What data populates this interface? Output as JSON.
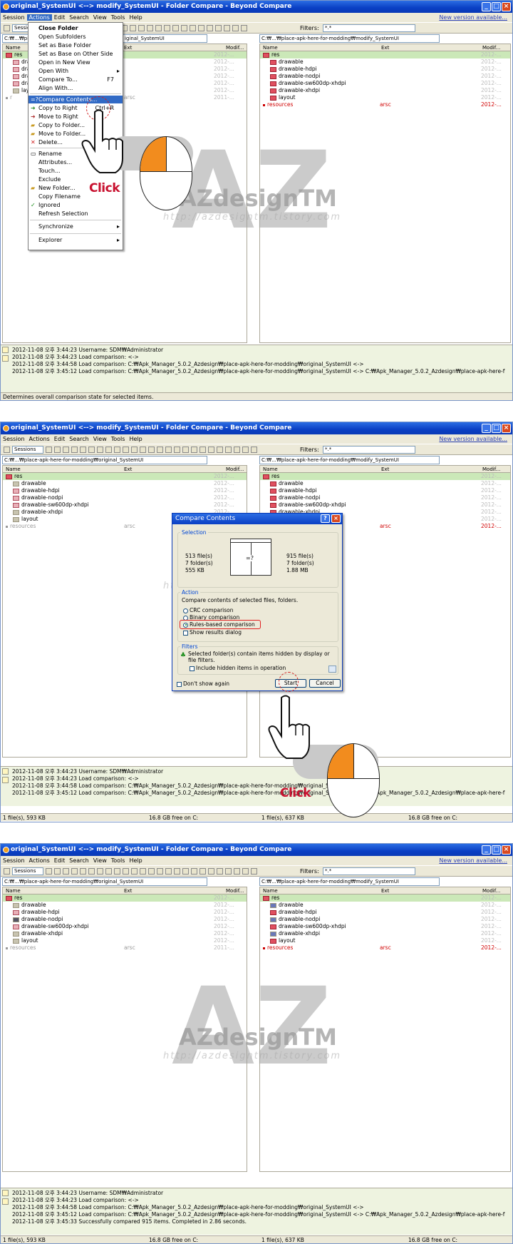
{
  "window": {
    "title": "original_SystemUI <--> modify_SystemUI - Folder Compare - Beyond Compare",
    "new_version": "New version available..."
  },
  "menu": [
    "Session",
    "Actions",
    "Edit",
    "Search",
    "View",
    "Tools",
    "Help"
  ],
  "toolbar": {
    "sessions": "Sessions",
    "filters_label": "Filters:",
    "filter_value": "*.*"
  },
  "paths": {
    "left": "C:₩...₩place-apk-here-for-modding₩original_SystemUI",
    "right": "C:₩...₩place-apk-here-for-modding₩modify_SystemUI",
    "left_short": "C:₩...₩pl",
    "left_tail": "iginal_SystemUI"
  },
  "columns": {
    "name": "Name",
    "ext": "Ext",
    "modified": "Modif..."
  },
  "tree": {
    "root": "res",
    "folders": [
      "drawable",
      "drawable-hdpi",
      "drawable-nodpi",
      "drawable-sw600dp-xhdpi",
      "drawable-xhdpi",
      "layout"
    ],
    "resources": "resources",
    "ext": "arsc",
    "mod_left": "2012-...",
    "mod_left_old": "2011-...",
    "mod_right": "2012-..."
  },
  "actions_menu": [
    {
      "label": "Close Folder",
      "bold": true
    },
    {
      "label": "Open Subfolders"
    },
    {
      "label": "Set as Base Folder"
    },
    {
      "label": "Set as Base on Other Side"
    },
    {
      "label": "Open in New View"
    },
    {
      "label": "Open With",
      "submenu": true
    },
    {
      "label": "Compare To...",
      "shortcut": "F7"
    },
    {
      "label": "Align With..."
    },
    {
      "label": "Compare Contents...",
      "highlighted": true,
      "icon": "=?"
    },
    {
      "label": "Copy to Right",
      "shortcut": "Ctrl+R"
    },
    {
      "label": "Move to Right"
    },
    {
      "label": "Copy to Folder..."
    },
    {
      "label": "Move to Folder..."
    },
    {
      "label": "Delete..."
    },
    {
      "label": "Rename"
    },
    {
      "label": "Attributes..."
    },
    {
      "label": "Touch..."
    },
    {
      "label": "Exclude"
    },
    {
      "label": "New Folder..."
    },
    {
      "label": "Copy Filename"
    },
    {
      "label": "Ignored",
      "check": true
    },
    {
      "label": "Refresh Selection"
    },
    {
      "label": "Synchronize",
      "submenu": true
    },
    {
      "label": "Explorer",
      "submenu": true
    }
  ],
  "log": {
    "l1": "2012-11-08 오후 3:44:23  Username: SDM₩Administrator",
    "l2": "2012-11-08 오후 3:44:23  Load comparison:  <->",
    "l3": "2012-11-08 오후 3:44:58  Load comparison: C:₩Apk_Manager_5.0.2_Azdesign₩place-apk-here-for-modding₩original_SystemUI <->",
    "l4": "2012-11-08 오후 3:45:12  Load comparison: C:₩Apk_Manager_5.0.2_Azdesign₩place-apk-here-for-modding₩original_SystemUI <-> C:₩Apk_Manager_5.0.2_Azdesign₩place-apk-here-f",
    "l5": "2012-11-08 오후 3:45:33  Successfully compared 915 items.   Completed in 2.86 seconds."
  },
  "status": {
    "hint": "Determines overall comparison state for selected items.",
    "left_files": "1 file(s), 593 KB",
    "left_free": "16.8 GB free on C:",
    "right_files": "1 file(s), 637 KB",
    "right_free": "16.8 GB free on C:"
  },
  "dialog": {
    "title": "Compare Contents",
    "selection_label": "Selection",
    "left_files": "513 file(s)",
    "left_folders": "7 folder(s)",
    "left_size": "555 KB",
    "right_files": "915 file(s)",
    "right_folders": "7 folder(s)",
    "right_size": "1.88 MB",
    "action_label": "Action",
    "action_desc": "Compare contents of selected files, folders.",
    "crc": "CRC comparison",
    "binary": "Binary comparison",
    "rules": "Rules-based comparison",
    "show_results": "Show results dialog",
    "filters_label": "Filters",
    "filters_desc1": "Selected folder(s) contain items hidden by display or",
    "filters_desc2": "file filters.",
    "include_hidden": "Include hidden items in operation",
    "dont_show": "Don't show again",
    "start": "Start",
    "cancel": "Cancel",
    "eq_icon": "=?"
  },
  "annotation": {
    "click": "Click"
  },
  "watermark": {
    "brand": "AZdesignTM",
    "url": "http://azdesigntm.tistory.com",
    "letters": "AZ"
  },
  "colors": {
    "title_blue": "#0a3fc4",
    "menu_bg": "#ece9d8",
    "highlight": "#316ac5",
    "diff_red": "#d00000",
    "selected_row": "#cbe8b8",
    "mouse_orange": "#f28c1e",
    "click_red": "#c8102e"
  }
}
